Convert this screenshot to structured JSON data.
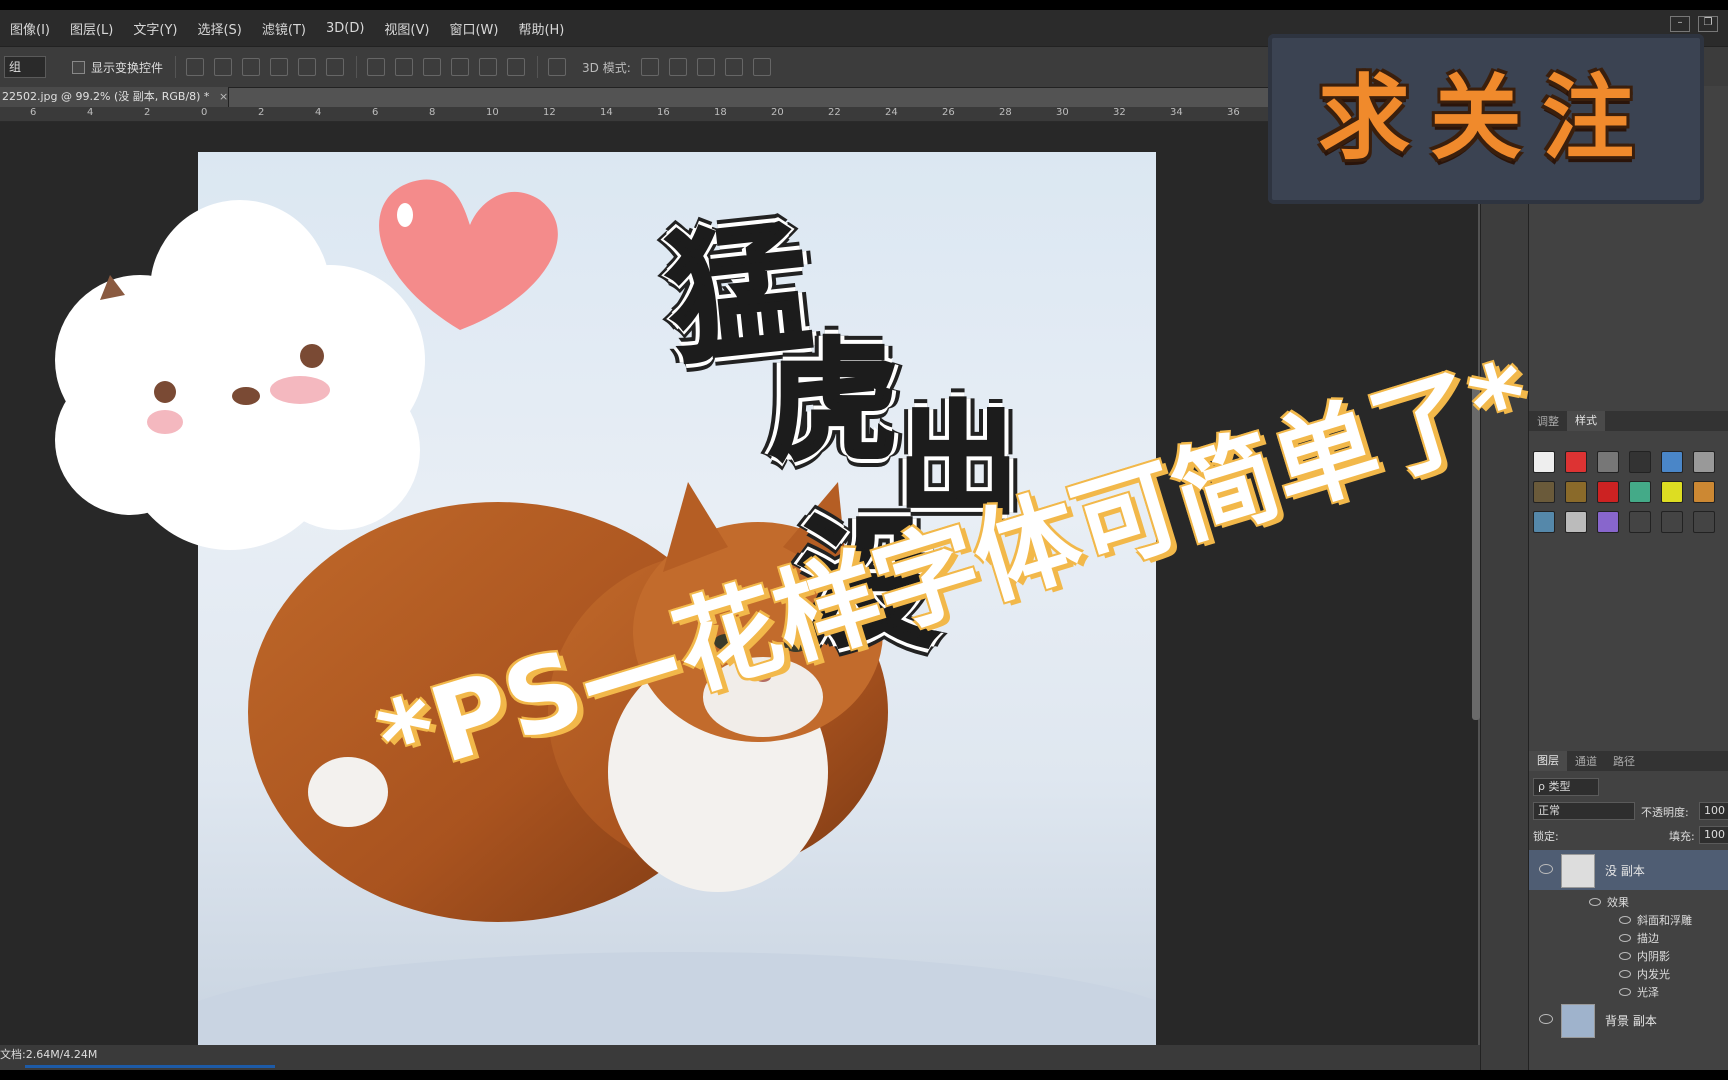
{
  "menu": [
    "图像(I)",
    "图层(L)",
    "文字(Y)",
    "选择(S)",
    "滤镜(T)",
    "3D(D)",
    "视图(V)",
    "窗口(W)",
    "帮助(H)"
  ],
  "options": {
    "group_select": "组",
    "show_transform": "显示变换控件",
    "mode3d": "3D 模式:"
  },
  "doc_tab": {
    "title": "22502.jpg @ 99.2% (没 副本, RGB/8) *",
    "close": "×"
  },
  "ruler": [
    "6",
    "4",
    "2",
    "0",
    "2",
    "4",
    "6",
    "8",
    "10",
    "12",
    "14",
    "16",
    "18",
    "20",
    "22",
    "24",
    "26",
    "28",
    "30",
    "32",
    "34",
    "36"
  ],
  "artwork": {
    "cloud_text": "",
    "art_lines": [
      "猛",
      "虎",
      "出",
      "没"
    ]
  },
  "overlay": {
    "badge": "求关注",
    "headline": "*PS—花样字体可简单了*"
  },
  "status": {
    "doc_size": "文档:2.64M/4.24M"
  },
  "styles_panel": {
    "tabs": [
      "调整",
      "样式"
    ],
    "active": "样式"
  },
  "layers_panel": {
    "tabs": [
      "图层",
      "通道",
      "路径"
    ],
    "filter_kind": "ρ 类型",
    "blend_mode": "正常",
    "opacity_label": "不透明度:",
    "opacity_value": "100",
    "lock_label": "锁定:",
    "fill_label": "填充:",
    "fill_value": "100",
    "layers": [
      {
        "name": "没 副本",
        "selected": true
      },
      {
        "name": "背景 副本",
        "selected": false
      }
    ],
    "effects_label": "效果",
    "effects": [
      "斜面和浮雕",
      "描边",
      "内阴影",
      "内发光",
      "光泽"
    ]
  },
  "colors": {
    "accent_orange": "#f08a2c",
    "headline_stroke": "#f2b84a",
    "badge_bg": "#3b4352"
  }
}
